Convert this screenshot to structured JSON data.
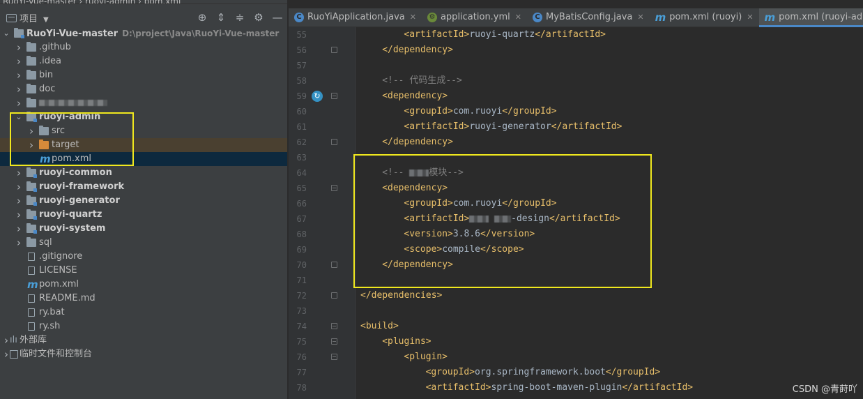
{
  "breadcrumb": "RuoYi-Vue-master  ›  ruoyi-admin  ›  pom.xml",
  "project_panel": {
    "title": "项目",
    "toolbar_icons": [
      "locate-icon",
      "expand-all-icon",
      "collapse-all-icon",
      "gear-icon",
      "minimize-icon"
    ],
    "tree": [
      {
        "indent": 0,
        "arrow": "expanded",
        "icon": "project",
        "label": "RuoYi-Vue-master",
        "path": "D:\\project\\Java\\RuoYi-Vue-master",
        "bold": true
      },
      {
        "indent": 1,
        "arrow": "collapsed",
        "icon": "folder",
        "label": ".github"
      },
      {
        "indent": 1,
        "arrow": "collapsed",
        "icon": "folder",
        "label": ".idea"
      },
      {
        "indent": 1,
        "arrow": "collapsed",
        "icon": "folder",
        "label": "bin"
      },
      {
        "indent": 1,
        "arrow": "collapsed",
        "icon": "folder",
        "label": "doc"
      },
      {
        "indent": 1,
        "arrow": "collapsed",
        "icon": "folder",
        "label": "",
        "blurred": true
      },
      {
        "indent": 1,
        "arrow": "expanded",
        "icon": "module",
        "label": "ruoyi-admin",
        "bold": true
      },
      {
        "indent": 2,
        "arrow": "collapsed",
        "icon": "folder",
        "label": "src"
      },
      {
        "indent": 2,
        "arrow": "collapsed",
        "icon": "folder-orange",
        "label": "target",
        "excluded": true
      },
      {
        "indent": 2,
        "arrow": "",
        "icon": "maven",
        "label": "pom.xml",
        "selected": true
      },
      {
        "indent": 1,
        "arrow": "collapsed",
        "icon": "module",
        "label": "ruoyi-common",
        "bold": true
      },
      {
        "indent": 1,
        "arrow": "collapsed",
        "icon": "module",
        "label": "ruoyi-framework",
        "bold": true
      },
      {
        "indent": 1,
        "arrow": "collapsed",
        "icon": "module",
        "label": "ruoyi-generator",
        "bold": true
      },
      {
        "indent": 1,
        "arrow": "collapsed",
        "icon": "module",
        "label": "ruoyi-quartz",
        "bold": true
      },
      {
        "indent": 1,
        "arrow": "collapsed",
        "icon": "module",
        "label": "ruoyi-system",
        "bold": true
      },
      {
        "indent": 1,
        "arrow": "collapsed",
        "icon": "folder",
        "label": "sql"
      },
      {
        "indent": 1,
        "arrow": "",
        "icon": "file",
        "label": ".gitignore"
      },
      {
        "indent": 1,
        "arrow": "",
        "icon": "file",
        "label": "LICENSE"
      },
      {
        "indent": 1,
        "arrow": "",
        "icon": "maven",
        "label": "pom.xml"
      },
      {
        "indent": 1,
        "arrow": "",
        "icon": "file",
        "label": "README.md"
      },
      {
        "indent": 1,
        "arrow": "",
        "icon": "file",
        "label": "ry.bat"
      },
      {
        "indent": 1,
        "arrow": "",
        "icon": "file",
        "label": "ry.sh"
      },
      {
        "indent": 0,
        "arrow": "collapsed",
        "icon": "library",
        "label": "外部库"
      },
      {
        "indent": 0,
        "arrow": "collapsed",
        "icon": "scratch",
        "label": "临时文件和控制台"
      }
    ]
  },
  "tabs": [
    {
      "label": "RuoYiApplication.java",
      "icon": "java",
      "active": false
    },
    {
      "label": "application.yml",
      "icon": "config",
      "active": false
    },
    {
      "label": "MyBatisConfig.java",
      "icon": "java",
      "active": false
    },
    {
      "label": "pom.xml (ruoyi)",
      "icon": "maven",
      "active": false
    },
    {
      "label": "pom.xml (ruoyi-admin)",
      "icon": "maven",
      "active": true
    }
  ],
  "editor": {
    "lines": [
      {
        "n": 55,
        "indent": 2,
        "parts": [
          [
            "tag",
            "<artifactId>"
          ],
          [
            "txt",
            "ruoyi-quartz"
          ],
          [
            "tag",
            "</artifactId>"
          ]
        ]
      },
      {
        "n": 56,
        "indent": 1,
        "parts": [
          [
            "tag",
            "</dependency>"
          ]
        ],
        "fold": "close"
      },
      {
        "n": 57,
        "indent": 0,
        "parts": []
      },
      {
        "n": 58,
        "indent": 1,
        "parts": [
          [
            "cmt",
            "<!-- 代码生成-->"
          ]
        ]
      },
      {
        "n": 59,
        "indent": 1,
        "parts": [
          [
            "tag",
            "<dependency>"
          ]
        ],
        "fold": "open"
      },
      {
        "n": 60,
        "indent": 2,
        "parts": [
          [
            "tag",
            "<groupId>"
          ],
          [
            "txt",
            "com.ruoyi"
          ],
          [
            "tag",
            "</groupId>"
          ]
        ]
      },
      {
        "n": 61,
        "indent": 2,
        "parts": [
          [
            "tag",
            "<artifactId>"
          ],
          [
            "txt",
            "ruoyi-generator"
          ],
          [
            "tag",
            "</artifactId>"
          ]
        ]
      },
      {
        "n": 62,
        "indent": 1,
        "parts": [
          [
            "tag",
            "</dependency>"
          ]
        ],
        "fold": "close"
      },
      {
        "n": 63,
        "indent": 0,
        "parts": []
      },
      {
        "n": 64,
        "indent": 1,
        "parts": [
          [
            "cmt",
            "<!-- "
          ],
          [
            "blur",
            "28"
          ],
          [
            "cmt",
            "模块-->"
          ]
        ]
      },
      {
        "n": 65,
        "indent": 1,
        "parts": [
          [
            "tag",
            "<dependency>"
          ]
        ],
        "fold": "open"
      },
      {
        "n": 66,
        "indent": 2,
        "parts": [
          [
            "tag",
            "<groupId>"
          ],
          [
            "txt",
            "com.ruoyi"
          ],
          [
            "tag",
            "</groupId>"
          ]
        ]
      },
      {
        "n": 67,
        "indent": 2,
        "parts": [
          [
            "tag",
            "<artifactId>"
          ],
          [
            "blur",
            "28"
          ],
          [
            "txt",
            " "
          ],
          [
            "blur",
            "24"
          ],
          [
            "txt",
            "-design"
          ],
          [
            "tag",
            "</artifactId>"
          ]
        ]
      },
      {
        "n": 68,
        "indent": 2,
        "parts": [
          [
            "tag",
            "<version>"
          ],
          [
            "txt",
            "3.8.6"
          ],
          [
            "tag",
            "</version>"
          ]
        ]
      },
      {
        "n": 69,
        "indent": 2,
        "parts": [
          [
            "tag",
            "<scope>"
          ],
          [
            "txt",
            "compile"
          ],
          [
            "tag",
            "</scope>"
          ]
        ]
      },
      {
        "n": 70,
        "indent": 1,
        "parts": [
          [
            "tag",
            "</dependency>"
          ]
        ],
        "fold": "close"
      },
      {
        "n": 71,
        "indent": 0,
        "parts": []
      },
      {
        "n": 72,
        "indent": 0,
        "parts": [
          [
            "tag",
            "</dependencies>"
          ]
        ],
        "fold": "close"
      },
      {
        "n": 73,
        "indent": 0,
        "parts": []
      },
      {
        "n": 74,
        "indent": 0,
        "parts": [
          [
            "tag",
            "<build>"
          ]
        ],
        "fold": "open"
      },
      {
        "n": 75,
        "indent": 1,
        "parts": [
          [
            "tag",
            "<plugins>"
          ]
        ],
        "fold": "open"
      },
      {
        "n": 76,
        "indent": 2,
        "parts": [
          [
            "tag",
            "<plugin>"
          ]
        ],
        "fold": "open"
      },
      {
        "n": 77,
        "indent": 3,
        "parts": [
          [
            "tag",
            "<groupId>"
          ],
          [
            "txt",
            "org.springframework.boot"
          ],
          [
            "tag",
            "</groupId>"
          ]
        ]
      },
      {
        "n": 78,
        "indent": 3,
        "parts": [
          [
            "tag",
            "<artifactId>"
          ],
          [
            "txt",
            "spring-boot-maven-plugin"
          ],
          [
            "tag",
            "</artifactId>"
          ]
        ]
      }
    ]
  },
  "watermark": "CSDN @青莳吖",
  "colors": {
    "highlight_box": "#f0e81e",
    "tag": "#e8bf6a",
    "text": "#a9b7c6",
    "comment": "#808080",
    "tab_active_underline": "#4a88c7"
  }
}
